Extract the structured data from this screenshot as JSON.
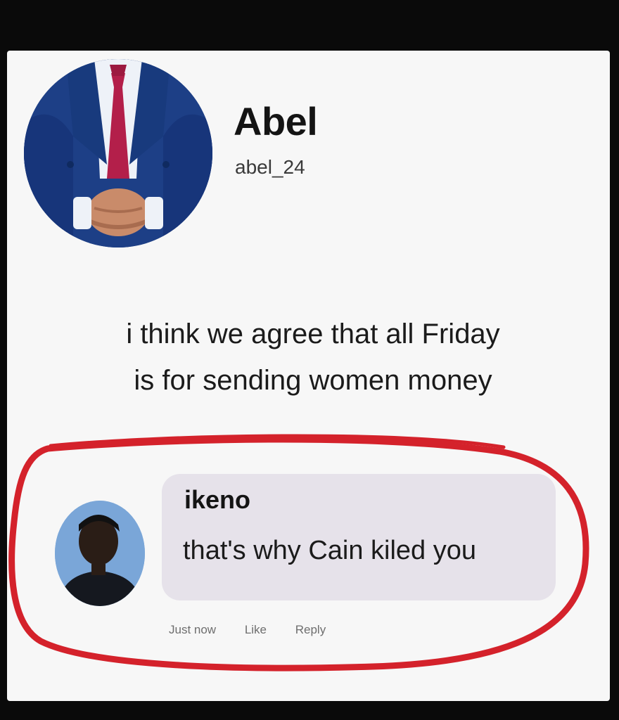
{
  "post": {
    "author_name": "Abel",
    "author_handle": "abel_24",
    "body_line_1": "i think we agree that all Friday",
    "body_line_2": "is for sending women money"
  },
  "comment": {
    "commenter_name": "ikeno",
    "text": "that's why Cain kiled you",
    "actions": {
      "time": "Just now",
      "like": "Like",
      "reply": "Reply"
    }
  },
  "colors": {
    "background": "#0a0a0a",
    "card": "#f7f7f7",
    "comment_bubble": "#e6e2ea",
    "annotation_circle": "#d4222b",
    "suit_blue": "#1d3f86",
    "tie": "#b31f4a"
  },
  "icons": {
    "author_avatar": "man-in-blue-suit-avatar",
    "commenter_avatar": "person-avatar"
  }
}
